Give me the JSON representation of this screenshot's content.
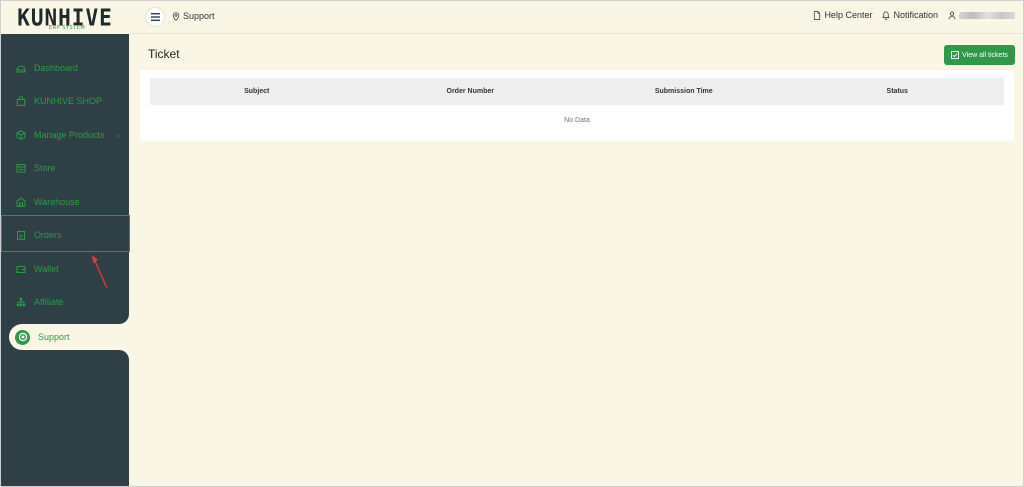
{
  "logo": {
    "text": "KUNHIVE",
    "sub": "ERP SYSTEM"
  },
  "header": {
    "breadcrumb": "Support",
    "help_center": "Help Center",
    "notification": "Notification"
  },
  "sidebar": {
    "items": [
      {
        "label": "Dashboard",
        "icon": "dashboard-icon"
      },
      {
        "label": "KUNHIVE SHOP",
        "icon": "shopping-bag-icon"
      },
      {
        "label": "Manage Products",
        "icon": "box-icon",
        "chevron": "›"
      },
      {
        "label": "Store",
        "icon": "store-icon"
      },
      {
        "label": "Warehouse",
        "icon": "warehouse-icon"
      },
      {
        "label": "Orders",
        "icon": "orders-icon"
      },
      {
        "label": "Wallet",
        "icon": "wallet-icon"
      },
      {
        "label": "Affiliate",
        "icon": "affiliate-icon"
      },
      {
        "label": "Support",
        "icon": "support-icon",
        "active": true
      }
    ]
  },
  "main": {
    "title": "Ticket",
    "view_button": "View all tickets",
    "table": {
      "columns": [
        "Subject",
        "Order Number",
        "Submission Time",
        "Status"
      ],
      "empty_text": "No Data"
    }
  },
  "colors": {
    "accent": "#2e9a47",
    "sidebar_bg": "#2f3f46",
    "page_bg": "#faf6e6",
    "highlight": "#e03a3a"
  }
}
